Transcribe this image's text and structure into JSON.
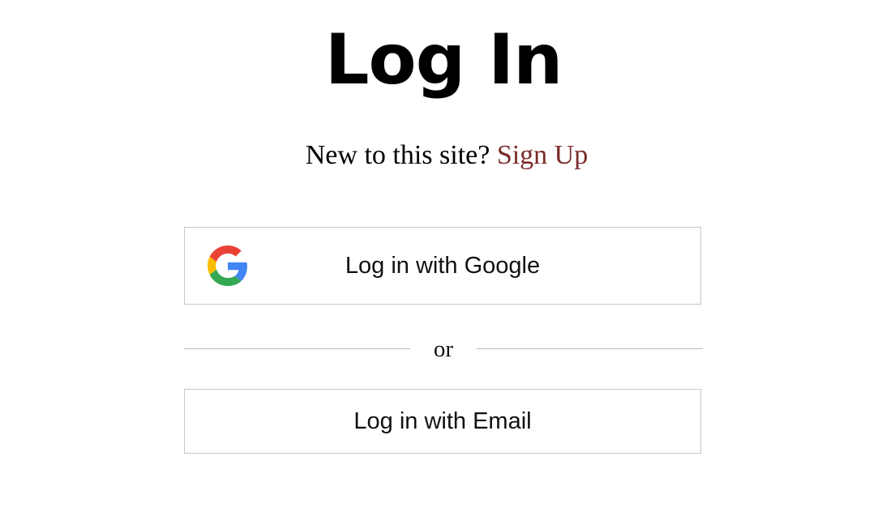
{
  "page": {
    "title": "Log In",
    "subtitle_text": "New to this site?",
    "signup_link": "Sign Up"
  },
  "buttons": {
    "google_label": "Log in with Google",
    "email_label": "Log in with Email"
  },
  "divider": {
    "text": "or"
  },
  "colors": {
    "link": "#7a2c2a",
    "border": "#c8c8c8",
    "google_blue": "#4285F4",
    "google_green": "#34A853",
    "google_yellow": "#FBBC05",
    "google_red": "#EA4335"
  },
  "icons": {
    "google": "google-g-logo"
  }
}
